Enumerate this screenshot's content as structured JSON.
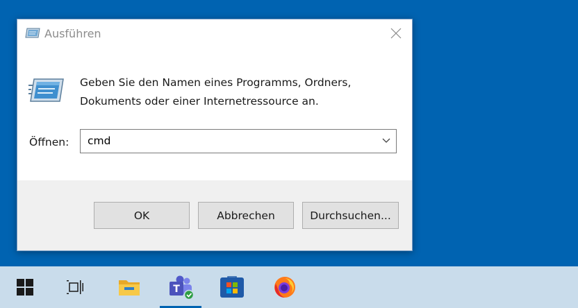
{
  "dialog": {
    "title": "Ausführen",
    "prompt_line1": "Geben Sie den Namen eines Programms, Ordners,",
    "prompt_line2": "Dokuments oder einer Internetressource an.",
    "open_label": "Öffnen:",
    "open_value": "cmd",
    "buttons": {
      "ok": "OK",
      "cancel": "Abbrechen",
      "browse": "Durchsuchen..."
    }
  },
  "taskbar": {
    "items": [
      {
        "name": "start",
        "icon": "windows-logo-icon"
      },
      {
        "name": "task-view",
        "icon": "task-view-icon"
      },
      {
        "name": "file-explorer",
        "icon": "folder-icon"
      },
      {
        "name": "teams",
        "icon": "teams-icon"
      },
      {
        "name": "microsoft-store",
        "icon": "store-icon"
      },
      {
        "name": "firefox",
        "icon": "firefox-icon"
      }
    ]
  },
  "colors": {
    "desktop": "#0063b1",
    "taskbar": "#c9dceb",
    "dialog_footer": "#f0f0f0",
    "button": "#e1e1e1"
  }
}
